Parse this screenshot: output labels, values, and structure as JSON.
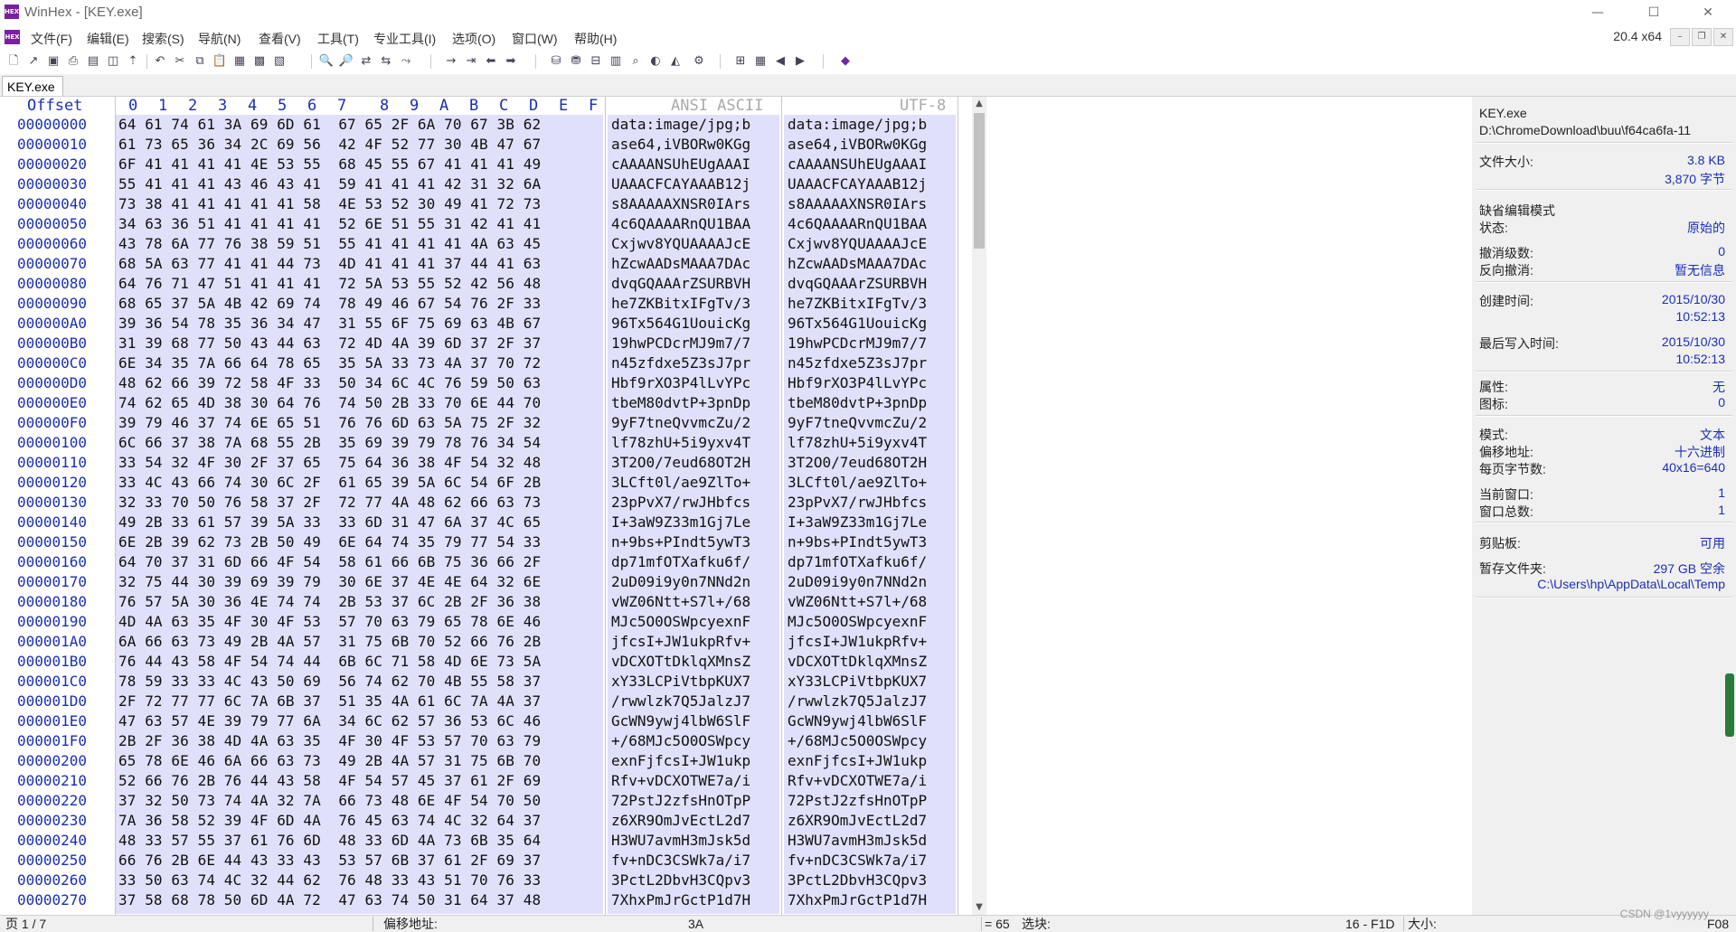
{
  "window": {
    "title": "WinHex - [KEY.exe]",
    "app_icon": "HEX",
    "minimize": "—",
    "maximize": "☐",
    "close": "✕"
  },
  "menu": {
    "items": [
      "文件(F)",
      "编辑(E)",
      "搜索(S)",
      "导航(N)",
      "查看(V)",
      "工具(T)",
      "专业工具(I)",
      "选项(O)",
      "窗口(W)",
      "帮助(H)"
    ],
    "version": "20.4 x64"
  },
  "tab": {
    "label": "KEY.exe"
  },
  "hex": {
    "header": {
      "offset": "Offset",
      "columns": [
        "0",
        "1",
        "2",
        "3",
        "4",
        "5",
        "6",
        "7",
        "8",
        "9",
        "A",
        "B",
        "C",
        "D",
        "E",
        "F"
      ],
      "ansi": "ANSI ASCII",
      "utf8": "UTF-8"
    },
    "rows": [
      {
        "off": "00000000",
        "hex": "64 61 74 61 3A 69 6D 61  67 65 2F 6A 70 67 3B 62",
        "ansi": "data:image/jpg;b"
      },
      {
        "off": "00000010",
        "hex": "61 73 65 36 34 2C 69 56  42 4F 52 77 30 4B 47 67",
        "ansi": "ase64,iVBORw0KGg"
      },
      {
        "off": "00000020",
        "hex": "6F 41 41 41 41 4E 53 55  68 45 55 67 41 41 41 49",
        "ansi": "cAAAANSUhEUgAAAI"
      },
      {
        "off": "00000030",
        "hex": "55 41 41 41 43 46 43 41  59 41 41 41 42 31 32 6A",
        "ansi": "UAAACFCAYAAAB12j"
      },
      {
        "off": "00000040",
        "hex": "73 38 41 41 41 41 41 58  4E 53 52 30 49 41 72 73",
        "ansi": "s8AAAAAXNSR0IArs"
      },
      {
        "off": "00000050",
        "hex": "34 63 36 51 41 41 41 41  52 6E 51 55 31 42 41 41",
        "ansi": "4c6QAAAARnQU1BAA"
      },
      {
        "off": "00000060",
        "hex": "43 78 6A 77 76 38 59 51  55 41 41 41 41 4A 63 45",
        "ansi": "Cxjwv8YQUAAAAJcE"
      },
      {
        "off": "00000070",
        "hex": "68 5A 63 77 41 41 44 73  4D 41 41 41 37 44 41 63",
        "ansi": "hZcwAADsMAAA7DAc"
      },
      {
        "off": "00000080",
        "hex": "64 76 71 47 51 41 41 41  72 5A 53 55 52 42 56 48",
        "ansi": "dvqGQAAArZSURBVH"
      },
      {
        "off": "00000090",
        "hex": "68 65 37 5A 4B 42 69 74  78 49 46 67 54 76 2F 33",
        "ansi": "he7ZKBitxIFgTv/3"
      },
      {
        "off": "000000A0",
        "hex": "39 36 54 78 35 36 34 47  31 55 6F 75 69 63 4B 67",
        "ansi": "96Tx564G1UouicKg"
      },
      {
        "off": "000000B0",
        "hex": "31 39 68 77 50 43 44 63  72 4D 4A 39 6D 37 2F 37",
        "ansi": "19hwPCDcrMJ9m7/7"
      },
      {
        "off": "000000C0",
        "hex": "6E 34 35 7A 66 64 78 65  35 5A 33 73 4A 37 70 72",
        "ansi": "n45zfdxe5Z3sJ7pr"
      },
      {
        "off": "000000D0",
        "hex": "48 62 66 39 72 58 4F 33  50 34 6C 4C 76 59 50 63",
        "ansi": "Hbf9rXO3P4lLvYPc"
      },
      {
        "off": "000000E0",
        "hex": "74 62 65 4D 38 30 64 76  74 50 2B 33 70 6E 44 70",
        "ansi": "tbeM80dvtP+3pnDp"
      },
      {
        "off": "000000F0",
        "hex": "39 79 46 37 74 6E 65 51  76 76 6D 63 5A 75 2F 32",
        "ansi": "9yF7tneQvvmcZu/2"
      },
      {
        "off": "00000100",
        "hex": "6C 66 37 38 7A 68 55 2B  35 69 39 79 78 76 34 54",
        "ansi": "lf78zhU+5i9yxv4T"
      },
      {
        "off": "00000110",
        "hex": "33 54 32 4F 30 2F 37 65  75 64 36 38 4F 54 32 48",
        "ansi": "3T2O0/7eud68OT2H"
      },
      {
        "off": "00000120",
        "hex": "33 4C 43 66 74 30 6C 2F  61 65 39 5A 6C 54 6F 2B",
        "ansi": "3LCft0l/ae9ZlTo+"
      },
      {
        "off": "00000130",
        "hex": "32 33 70 50 76 58 37 2F  72 77 4A 48 62 66 63 73",
        "ansi": "23pPvX7/rwJHbfcs"
      },
      {
        "off": "00000140",
        "hex": "49 2B 33 61 57 39 5A 33  33 6D 31 47 6A 37 4C 65",
        "ansi": "I+3aW9Z33m1Gj7Le"
      },
      {
        "off": "00000150",
        "hex": "6E 2B 39 62 73 2B 50 49  6E 64 74 35 79 77 54 33",
        "ansi": "n+9bs+PIndt5ywT3"
      },
      {
        "off": "00000160",
        "hex": "64 70 37 31 6D 66 4F 54  58 61 66 6B 75 36 66 2F",
        "ansi": "dp71mfOTXafku6f/"
      },
      {
        "off": "00000170",
        "hex": "32 75 44 30 39 69 39 79  30 6E 37 4E 4E 64 32 6E",
        "ansi": "2uD09i9y0n7NNd2n"
      },
      {
        "off": "00000180",
        "hex": "76 57 5A 30 36 4E 74 74  2B 53 37 6C 2B 2F 36 38",
        "ansi": "vWZ06Ntt+S7l+/68"
      },
      {
        "off": "00000190",
        "hex": "4D 4A 63 35 4F 30 4F 53  57 70 63 79 65 78 6E 46",
        "ansi": "MJc5O0OSWpcyexnF"
      },
      {
        "off": "000001A0",
        "hex": "6A 66 63 73 49 2B 4A 57  31 75 6B 70 52 66 76 2B",
        "ansi": "jfcsI+JW1ukpRfv+"
      },
      {
        "off": "000001B0",
        "hex": "76 44 43 58 4F 54 74 44  6B 6C 71 58 4D 6E 73 5A",
        "ansi": "vDCXOTtDklqXMnsZ"
      },
      {
        "off": "000001C0",
        "hex": "78 59 33 33 4C 43 50 69  56 74 62 70 4B 55 58 37",
        "ansi": "xY33LCPiVtbpKUX7"
      },
      {
        "off": "000001D0",
        "hex": "2F 72 77 77 6C 7A 6B 37  51 35 4A 61 6C 7A 4A 37",
        "ansi": "/rwwlzk7Q5JalzJ7"
      },
      {
        "off": "000001E0",
        "hex": "47 63 57 4E 39 79 77 6A  34 6C 62 57 36 53 6C 46",
        "ansi": "GcWN9ywj4lbW6SlF"
      },
      {
        "off": "000001F0",
        "hex": "2B 2F 36 38 4D 4A 63 35  4F 30 4F 53 57 70 63 79",
        "ansi": "+/68MJc5O0OSWpcy"
      },
      {
        "off": "00000200",
        "hex": "65 78 6E 46 6A 66 63 73  49 2B 4A 57 31 75 6B 70",
        "ansi": "exnFjfcsI+JW1ukp"
      },
      {
        "off": "00000210",
        "hex": "52 66 76 2B 76 44 43 58  4F 54 57 45 37 61 2F 69",
        "ansi": "Rfv+vDCXOTWE7a/i"
      },
      {
        "off": "00000220",
        "hex": "37 32 50 73 74 4A 32 7A  66 73 48 6E 4F 54 70 50",
        "ansi": "72PstJ2zfsHnOTpP"
      },
      {
        "off": "00000230",
        "hex": "7A 36 58 52 39 4F 6D 4A  76 45 63 74 4C 32 64 37",
        "ansi": "z6XR9OmJvEctL2d7"
      },
      {
        "off": "00000240",
        "hex": "48 33 57 55 37 61 76 6D  48 33 6D 4A 73 6B 35 64",
        "ansi": "H3WU7avmH3mJsk5d"
      },
      {
        "off": "00000250",
        "hex": "66 76 2B 6E 44 43 33 43  53 57 6B 37 61 2F 69 37",
        "ansi": "fv+nDC3CSWk7a/i7"
      },
      {
        "off": "00000260",
        "hex": "33 50 63 74 4C 32 44 62  76 48 33 43 51 70 76 33",
        "ansi": "3PctL2DbvH3CQpv3"
      },
      {
        "off": "00000270",
        "hex": "37 58 68 78 50 6D 4A 72  47 63 74 50 31 64 37 48",
        "ansi": "7XhxPmJrGctP1d7H"
      }
    ]
  },
  "info": {
    "file_name": "KEY.exe",
    "file_path": "D:\\ChromeDownload\\buu\\f64ca6fa-11",
    "file_size_label": "文件大小:",
    "file_size_kb": "3.8 KB",
    "file_size_bytes": "3,870 字节",
    "edit_mode_title": "缺省编辑模式",
    "state_label": "状态:",
    "state_value": "原始的",
    "undo_level_label": "撤消级数:",
    "undo_level_value": "0",
    "reverse_undo_label": "反向撤消:",
    "reverse_undo_value": "暂无信息",
    "created_label": "创建时间:",
    "created_date": "2015/10/30",
    "created_time": "10:52:13",
    "modified_label": "最后写入时间:",
    "modified_date": "2015/10/30",
    "modified_time": "10:52:13",
    "attr_label": "属性:",
    "attr_value": "无",
    "icon_label": "图标:",
    "icon_value": "0",
    "mode_label": "模式:",
    "mode_value": "文本",
    "offset_addr_label": "偏移地址:",
    "offset_addr_value": "十六进制",
    "bytes_per_page_label": "每页字节数:",
    "bytes_per_page_value": "40x16=640",
    "current_window_label": "当前窗口:",
    "current_window_value": "1",
    "window_total_label": "窗口总数:",
    "window_total_value": "1",
    "clipboard_label": "剪贴板:",
    "clipboard_value": "可用",
    "temp_folder_label": "暂存文件夹:",
    "temp_folder_value": "297 GB 空余",
    "temp_folder_path": "C:\\Users\\hp\\AppData\\Local\\Temp"
  },
  "status": {
    "page": "页 1 / 7",
    "offset_label": "偏移地址:",
    "offset_value": "3A",
    "value": "= 65",
    "selection_label": "选块:",
    "selection_value": "16 - F1D",
    "size_label": "大小:",
    "size_value": "F08"
  },
  "watermark": "CSDN @1vyyyyyy"
}
